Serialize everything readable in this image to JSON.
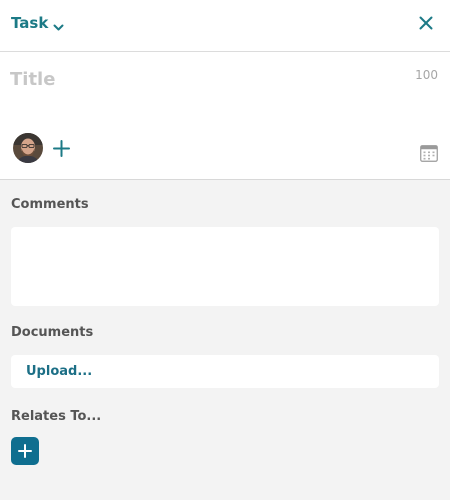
{
  "header": {
    "type_label": "Task",
    "dropdown_icon": "chevron-down-icon",
    "close_icon": "close-icon"
  },
  "title_field": {
    "placeholder": "Title",
    "value": "",
    "char_limit": "100"
  },
  "assignees": {
    "avatar_icon": "user-avatar",
    "add_icon": "plus-icon"
  },
  "due_date": {
    "icon": "calendar-icon"
  },
  "comments": {
    "label": "Comments",
    "value": ""
  },
  "documents": {
    "label": "Documents",
    "upload_label": "Upload..."
  },
  "relates_to": {
    "label": "Relates To...",
    "add_icon": "plus-icon"
  },
  "colors": {
    "accent": "#1c7a86",
    "primary_button": "#0f6e8f",
    "panel_background": "#f3f3f3",
    "surface": "#ffffff",
    "label_text": "#555555",
    "placeholder_text": "#c7c7c7"
  }
}
